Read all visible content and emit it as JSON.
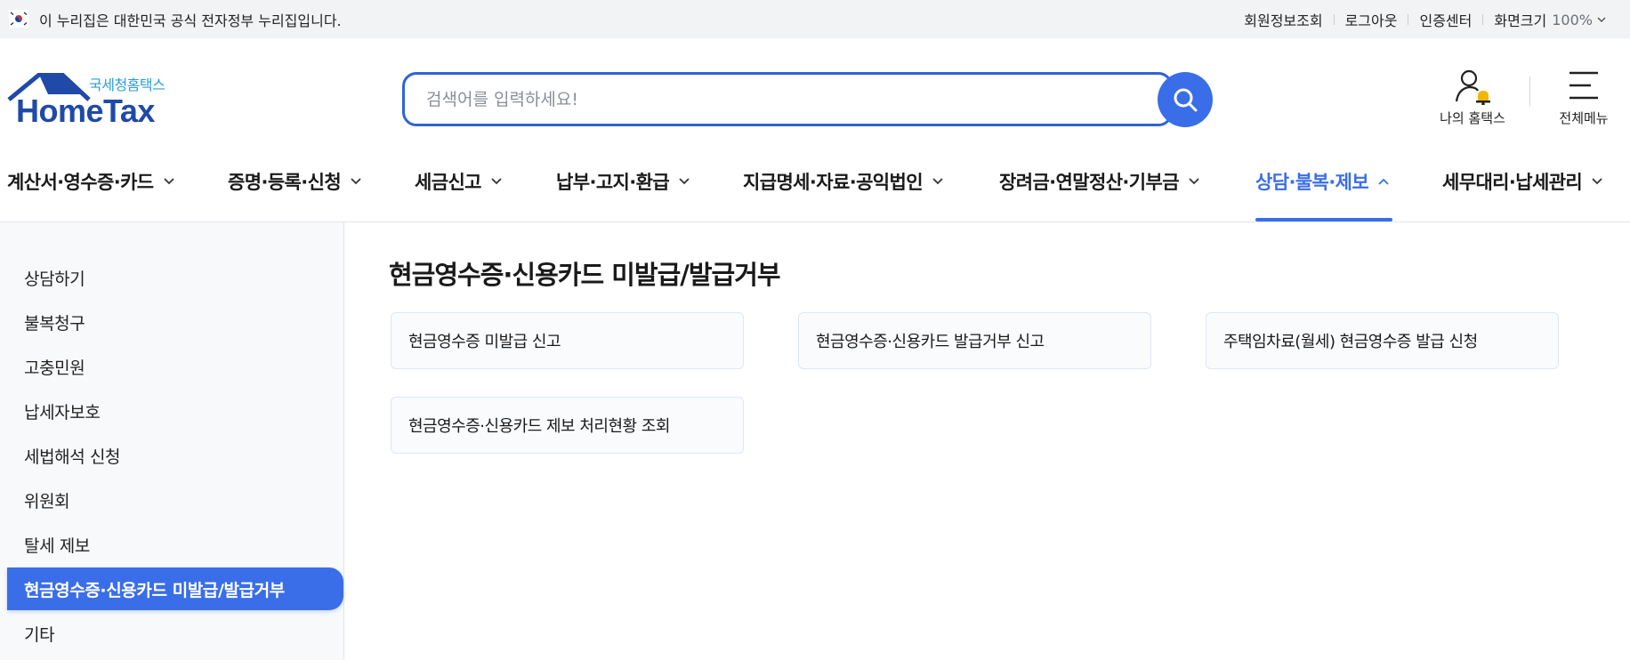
{
  "gov_bar": {
    "notice": "이 누리집은 대한민국 공식 전자정부 누리집입니다.",
    "links": [
      "회원정보조회",
      "로그아웃",
      "인증센터"
    ],
    "zoom_label": "화면크기",
    "zoom_value": "100%"
  },
  "logo": {
    "subtitle": "국세청홈택스",
    "name": "HomeTax"
  },
  "search": {
    "placeholder": "검색어를 입력하세요!",
    "value": ""
  },
  "header_actions": {
    "my_hometax": "나의 홈택스",
    "all_menu": "전체메뉴"
  },
  "gnb": [
    "계산서·영수증·카드",
    "증명·등록·신청",
    "세금신고",
    "납부·고지·환급",
    "지급명세·자료·공익법인",
    "장려금·연말정산·기부금",
    "상담·불복·제보",
    "세무대리·납세관리"
  ],
  "gnb_active": "상담·불복·제보",
  "sidebar": [
    "상담하기",
    "불복청구",
    "고충민원",
    "납세자보호",
    "세법해석 신청",
    "위원회",
    "탈세 제보",
    "현금영수증·신용카드 미발급/발급거부",
    "기타"
  ],
  "sidebar_active": "현금영수증·신용카드 미발급/발급거부",
  "main": {
    "title": "현금영수증·신용카드 미발급/발급거부",
    "cards": [
      "현금영수증 미발급 신고",
      "현금영수증·신용카드 발급거부 신고",
      "주택임차료(월세) 현금영수증 발급 신청",
      "현금영수증·신용카드 제보 처리현황 조회"
    ]
  },
  "colors": {
    "accent": "#3a6ee8",
    "search_border": "#2f63d6",
    "logo_blue": "#1f4aa8",
    "logo_sub": "#2a9fd6",
    "bell": "#f2b705"
  }
}
